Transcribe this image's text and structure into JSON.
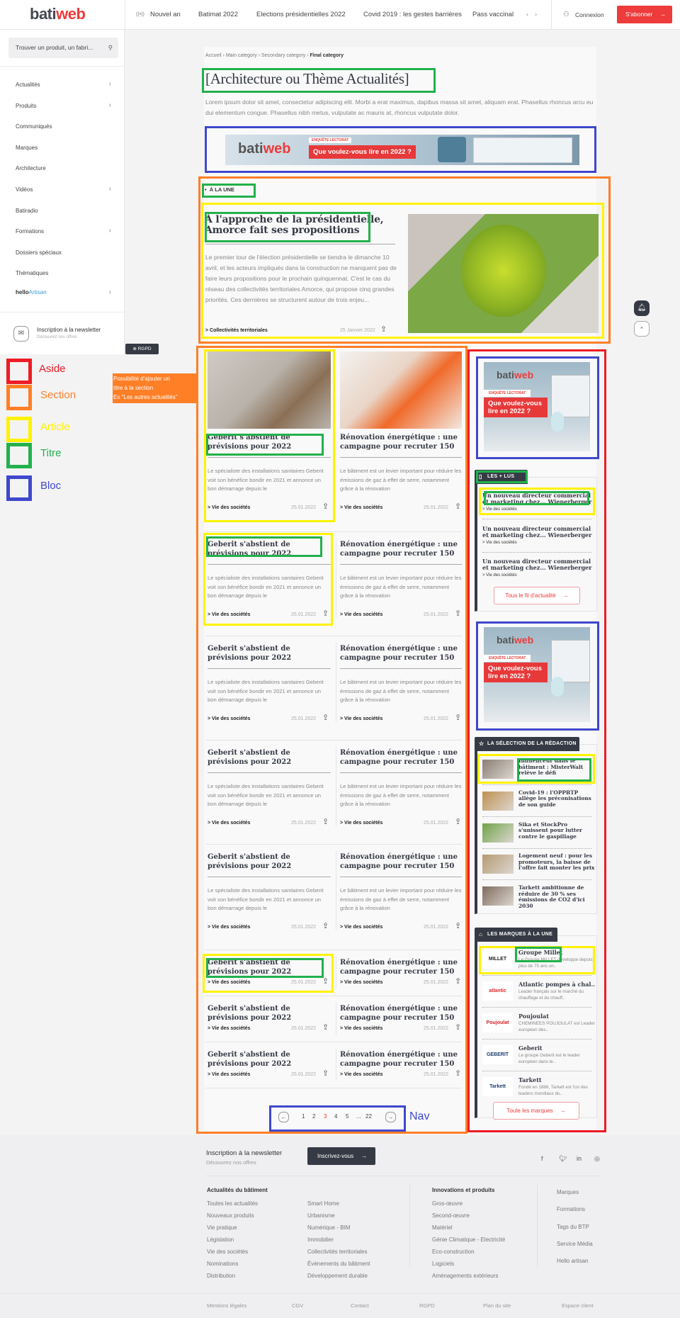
{
  "header": {
    "logo": {
      "bati": "bati",
      "web": "web"
    },
    "nav": [
      {
        "label": "Nouvel an",
        "icon": "live-icon"
      },
      {
        "label": "Batimat 2022"
      },
      {
        "label": "Elections présidentielles 2022"
      },
      {
        "label": "Covid 2019 : les gestes barrières"
      },
      {
        "label": "Pass vaccinal"
      }
    ],
    "login": "Connexion",
    "subscribe": "S'abonner"
  },
  "sidebar": {
    "search_placeholder": "Trouver un produit, un fabri...",
    "items": [
      {
        "label": "Actualités",
        "chevron": true
      },
      {
        "label": "Produits",
        "chevron": true
      },
      {
        "label": "Communiqués"
      },
      {
        "label": "Marques"
      },
      {
        "label": "Architecture"
      },
      {
        "label": "Vidéos",
        "chevron": true
      },
      {
        "label": "Batiradio"
      },
      {
        "label": "Formations",
        "chevron": true
      },
      {
        "label": "Dossiers spéciaux"
      },
      {
        "label": "Thématiques"
      }
    ],
    "hello": {
      "a": "hello",
      "b": "Artisan"
    },
    "newsletter": {
      "title": "Inscription à la newsletter",
      "subtitle": "Découvrez nos offres"
    },
    "rgpd": "RGPD"
  },
  "legend": {
    "items": [
      {
        "label": "Aside",
        "color": "#ee1c25"
      },
      {
        "label": "Section",
        "color": "#ff7f27"
      },
      {
        "label": "Article",
        "color": "#fff200"
      },
      {
        "label": "Titre",
        "color": "#22b14c"
      },
      {
        "label": "Bloc",
        "color": "#3f48cc"
      }
    ],
    "note": [
      "Possibilité d'ajouter un",
      "titre à la section",
      "Ex \"Les autres actualités\""
    ],
    "nav_label": "Nav"
  },
  "breadcrumb": [
    "Accueil",
    "Main category",
    "Secondary category",
    "Final category"
  ],
  "page_title": "[Architecture ou Thème Actualités]",
  "intro": "Lorem ipsum dolor sit amet, consectetur adipiscing elit. Morbi a erat maximus, dapibus massa sit amet, aliquam erat. Phasellus rhoncus arcu eu dui elementum congue. Phasellus nibh metus, vulputate ac mauris at, rhoncus vulputate dolor.",
  "banner": {
    "brand_a": "bati",
    "brand_b": "web",
    "tag": "ENQUÊTE LECTORAT",
    "headline": "Que voulez-vous lire en 2022 ?"
  },
  "une": {
    "label": "À LA UNE",
    "title": "À l'approche de la présidentielle, Amorce fait ses propositions",
    "excerpt": "Le premier tour de l'élection présidentielle se tiendra le dimanche 10 avril, et les acteurs impliqués dans la construction ne manquent pas de faire leurs propositions pour le prochain quinquennat. C'est le cas du réseau des collectivités territoriales Amorce, qui propose cinq grandes priorités. Ces dernières se structurent autour de trois enjeu...",
    "category": "> Collectivités territoriales",
    "date": "25 Janvier 2022"
  },
  "articles": {
    "a": {
      "title": "Geberit s'abstient de prévisions pour 2022",
      "excerpt": "Le spécialiste des installations sanitaires Geberit voit son bénéfice bondir en 2021 et annonce un bon démarrage depuis le",
      "category": "> Vie des sociétés",
      "date": "25.01.2022"
    },
    "b": {
      "title": "Rénovation énergétique : une campagne pour recruter 150 00...",
      "excerpt": "Le bâtiment est un levier important pour réduire les émissions de gaz à effet de serre, notamment grâce à la rénovation",
      "category": "> Vie des sociétés",
      "date": "25.01.2022"
    }
  },
  "pagination": {
    "pages": [
      "1",
      "2",
      "3",
      "4",
      "5",
      "...",
      "22"
    ],
    "current": "3",
    "accent": "#ee3b3b"
  },
  "aside": {
    "ad": {
      "brand_a": "bati",
      "brand_b": "web",
      "tag": "ENQUÊTE LECTORAT",
      "headline": "Que voulez-vous lire en 2022 ?"
    },
    "most_read": {
      "label": "LES + LUS",
      "items": [
        {
          "title": "Un nouveau directeur commercial et marketing chez... Wienerberger",
          "category": "> Vie des sociétés"
        },
        {
          "title": "Un nouveau directeur commercial et marketing chez... Wienerberger",
          "category": "> Vie des sociétés"
        },
        {
          "title": "Un nouveau directeur commercial et marketing chez... Wienerberger",
          "category": "> Vie des sociétés"
        }
      ],
      "button": "Tous le fil d'actualité"
    },
    "selection": {
      "label": "LA SÉLECTION DE LA RÉDACTION",
      "items": [
        {
          "title": "Influenceur dans le bâtiment : MisterWalt relève le défi"
        },
        {
          "title": "Covid-19 : l'OPPBTP allège les préconisations de son guide"
        },
        {
          "title": "Sika et StockPro s'unissent pour lutter contre le gaspillage"
        },
        {
          "title": "Logement neuf : pour les promoteurs, la baisse de l'offre fait monter les prix"
        },
        {
          "title": "Tarkett ambitionne de réduire de 30 % ses émissions de CO2 d'ici 2030"
        }
      ]
    },
    "brands": {
      "label": "LES MARQUES À LA UNE",
      "items": [
        {
          "name": "Groupe Millet",
          "desc": "Le Groupe MILLET développe depuis plus de 75 ans un..",
          "logo": "MILLET",
          "color": "#222"
        },
        {
          "name": "Atlantic pompes à chal...",
          "desc": "Leader français sur le marché du chauffage et du chauff..",
          "logo": "atlantic",
          "color": "#e0262b"
        },
        {
          "name": "Poujoulat",
          "desc": "CHEMINÉES POUJOULAT est Leader européen des..",
          "logo": "Poujoulat",
          "color": "#d8232a"
        },
        {
          "name": "Geberit",
          "desc": "Le groupe Geberit est le leader européen dans le..",
          "logo": "GEBERIT",
          "color": "#1d3e6e"
        },
        {
          "name": "Tarkett",
          "desc": "Fondé en 1886, Tarkett est l'un des leaders mondiaux du..",
          "logo": "Tarkett",
          "color": "#1d3e6e"
        }
      ],
      "button": "Toute les marques"
    }
  },
  "footer": {
    "newsletter": {
      "title": "Inscription à la newsletter",
      "subtitle": "Découvrez nos offres",
      "button": "Inscrivez-vous"
    },
    "socials": [
      "facebook-icon",
      "twitter-icon",
      "linkedin-icon",
      "instagram-icon"
    ],
    "col1": {
      "heading": "Actualités du bâtiment",
      "a": [
        "Toutes les actualités",
        "Nouveaux produits",
        "Vie pratique",
        "Législation",
        "Vie des sociétés",
        "Nominations",
        "Distribution"
      ],
      "b": [
        "Smart Home",
        "Urbanisme",
        "Numérique - BIM",
        "Immobilier",
        "Collectivités territoriales",
        "Évènements du bâtiment",
        "Développement durable"
      ]
    },
    "col2": {
      "heading": "Innovations et produits",
      "a": [
        "Gros-œuvre",
        "Second-œuvre",
        "Matériel",
        "Génie Climatique - Electricité",
        "Eco-construction",
        "Logiciels",
        "Aménagements extérieurs"
      ]
    },
    "col3": [
      "Marques",
      "Formations",
      "Tags du BTP",
      "Service Média",
      "Hello artisan"
    ],
    "bottom": [
      "Mentions légales",
      "CGV",
      "Contact",
      "RGPD",
      "Plan du site",
      "Espace client"
    ]
  }
}
